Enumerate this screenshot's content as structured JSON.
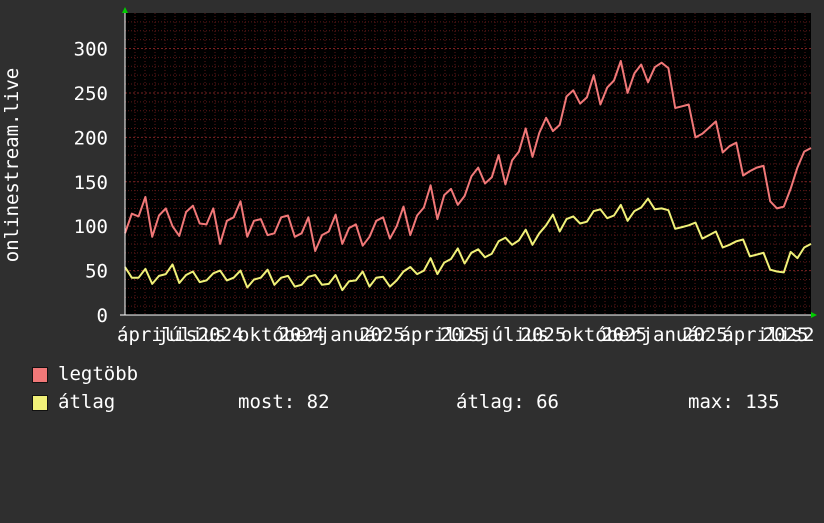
{
  "chart_data": {
    "type": "line",
    "ylabel": "onlinestream.live",
    "ylim": [
      0,
      340
    ],
    "y_ticks": [
      0,
      50,
      100,
      150,
      200,
      250,
      300
    ],
    "x_tick_labels": [
      "április",
      "július",
      "2024",
      "október",
      "2024",
      "január",
      "2025",
      "április",
      "2025",
      "július",
      "2025",
      "október",
      "2025",
      "január",
      "2025",
      "április",
      "2025",
      "2"
    ],
    "grid": true,
    "colors": {
      "background": "#2f2f2f",
      "plot": "#000000",
      "grid": "#5c1818",
      "axis": "#ffffff",
      "max": "#f07878",
      "avg": "#f0f078"
    },
    "series": [
      {
        "name": "legtöbb",
        "color": "#f07878",
        "values": [
          110,
          120,
          105,
          115,
          100,
          112,
          108,
          118,
          95,
          110,
          105,
          115,
          102,
          108,
          98,
          112,
          104,
          110,
          100,
          106,
          96,
          108,
          98,
          104,
          94,
          100,
          92,
          98,
          90,
          96,
          88,
          95,
          92,
          98,
          90,
          96,
          94,
          100,
          92,
          98,
          100,
          110,
          108,
          118,
          115,
          128,
          120,
          135,
          130,
          142,
          140,
          150,
          148,
          160,
          155,
          168,
          165,
          180,
          178,
          192,
          190,
          205,
          210,
          225,
          220,
          240,
          235,
          250,
          245,
          258,
          255,
          262,
          258,
          268,
          262,
          272,
          270,
          280,
          285,
          278,
          260,
          245,
          235,
          225,
          218,
          210,
          205,
          200,
          195,
          190,
          182,
          175,
          168,
          160,
          150,
          140,
          120,
          110,
          160,
          172,
          178,
          170
        ]
      },
      {
        "name": "átlag",
        "color": "#f0f078",
        "values": [
          45,
          48,
          42,
          46,
          44,
          47,
          43,
          48,
          42,
          45,
          43,
          46,
          42,
          44,
          41,
          45,
          42,
          44,
          40,
          43,
          39,
          42,
          40,
          42,
          38,
          41,
          37,
          40,
          36,
          40,
          35,
          39,
          37,
          41,
          36,
          40,
          38,
          42,
          37,
          41,
          42,
          46,
          45,
          52,
          50,
          58,
          55,
          62,
          60,
          66,
          64,
          70,
          68,
          74,
          72,
          80,
          78,
          85,
          84,
          90,
          88,
          95,
          98,
          104,
          100,
          108,
          105,
          112,
          108,
          114,
          110,
          115,
          112,
          118,
          115,
          120,
          118,
          122,
          125,
          120,
          112,
          106,
          102,
          98,
          95,
          92,
          90,
          88,
          85,
          82,
          80,
          76,
          72,
          68,
          64,
          60,
          52,
          45,
          62,
          70,
          76,
          74
        ]
      }
    ]
  },
  "legend": {
    "items": [
      {
        "label": "legtöbb",
        "color": "#f07878"
      },
      {
        "label": "átlag",
        "color": "#f0f078"
      }
    ],
    "stats": {
      "most": "most: 82",
      "atlag": "átlag: 66",
      "max": "max: 135"
    }
  }
}
